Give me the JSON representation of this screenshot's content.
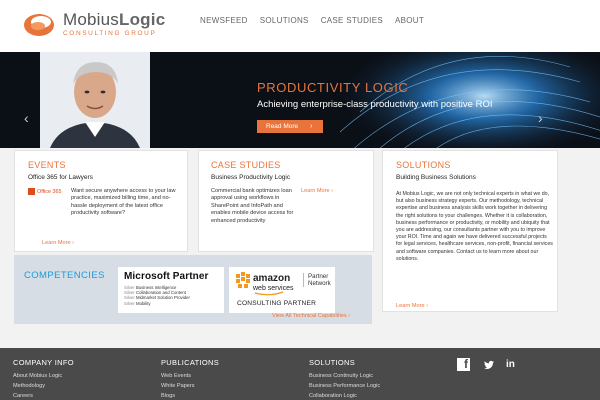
{
  "brand": {
    "name_part1": "Mobius",
    "name_part2": "Logic",
    "tagline": "CONSULTING GROUP",
    "accent": "#e8743b"
  },
  "nav": [
    "NEWSFEED",
    "SOLUTIONS",
    "CASE STUDIES",
    "ABOUT"
  ],
  "hero": {
    "title": "PRODUCTIVITY LOGIC",
    "subtitle": "Achieving enterprise-class productivity with positive ROI",
    "button_label": "Read More",
    "button_arrow": "›",
    "prev_arrow": "‹",
    "next_arrow": "›"
  },
  "events": {
    "title": "EVENTS",
    "subtitle": "Office 365 for Lawyers",
    "logo_text": "Office 365",
    "body": "Want secure anywhere access to your law practice, maximized billing time, and no-hassle deployment of the latest office productivity software?",
    "more": "Learn More ›"
  },
  "case_studies": {
    "title": "CASE STUDIES",
    "subtitle": "Business Productivity Logic",
    "body": "Commercial bank optimizes loan approval using workflows in SharePoint and InfoPath and enables mobile device access for enhanced productivity",
    "more": "Learn More ›"
  },
  "solutions": {
    "title": "SOLUTIONS",
    "subtitle": "Building Business Solutions",
    "body": "At Mobius Logic, we are not only technical experts in what we do, but also business strategy experts. Our methodology, technical expertise and business analysis skills work together in delivering the right solutions to your challenges. Whether it is collaboration, business performance or productivity, or mobility and ubiquity that you are addressing, our consultants partner with you to improve your ROI. Time and again we have delivered successful projects for legal services, healthcare services, non-profit, financial services and software companies. Contact us to learn more about our solutions.",
    "more": "Learn More ›"
  },
  "competencies": {
    "title": "COMPETENCIES",
    "microsoft": {
      "title": "Microsoft Partner",
      "items": [
        {
          "level": "Silver",
          "name": "Business Intelligence"
        },
        {
          "level": "Silver",
          "name": "Collaboration and Content"
        },
        {
          "level": "Silver",
          "name": "Midmarket Solution Provider"
        },
        {
          "level": "Silver",
          "name": "Mobility"
        }
      ]
    },
    "amazon": {
      "logo_line1": "amazon",
      "logo_line2": "web services",
      "partner_line1": "Partner",
      "partner_line2": "Network",
      "tier": "CONSULTING PARTNER"
    },
    "more": "View All Technical Capabilities ›"
  },
  "footer": {
    "columns": [
      {
        "heading": "COMPANY INFO",
        "links": [
          "About Mobius Logic",
          "Methodology",
          "Careers"
        ]
      },
      {
        "heading": "PUBLICATIONS",
        "links": [
          "Web Events",
          "White Papers",
          "Blogs"
        ]
      },
      {
        "heading": "SOLUTIONS",
        "links": [
          "Business Continuity Logic",
          "Business Performance Logic",
          "Collaboration Logic"
        ]
      }
    ],
    "social": {
      "facebook": "f",
      "linkedin": "in"
    }
  }
}
